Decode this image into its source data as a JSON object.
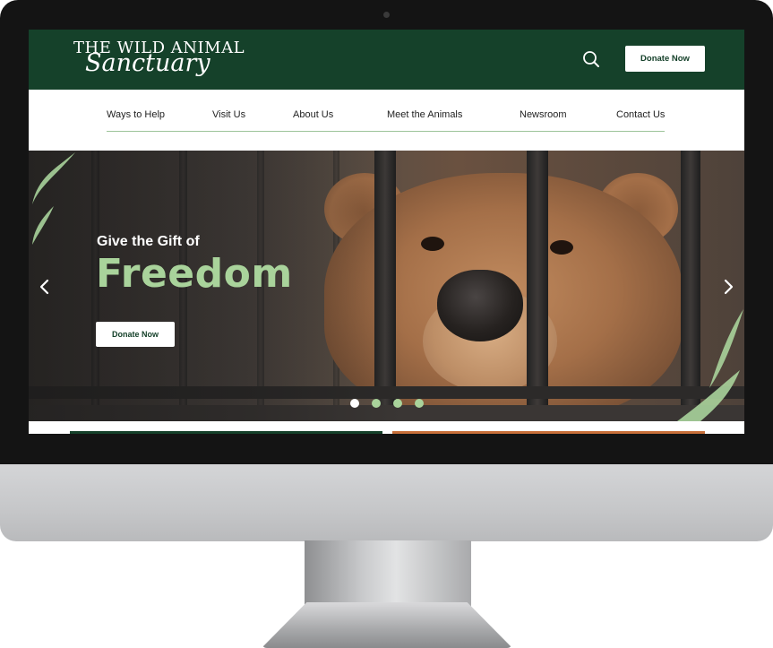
{
  "site": {
    "logo_line1": "THE WILD ANIMAL",
    "logo_line2": "Sanctuary",
    "header_donate": "Donate Now"
  },
  "nav": {
    "items": [
      {
        "label": "Ways to Help"
      },
      {
        "label": "Visit Us"
      },
      {
        "label": "About Us"
      },
      {
        "label": "Meet the Animals"
      },
      {
        "label": "Newsroom"
      },
      {
        "label": "Contact Us"
      }
    ]
  },
  "hero": {
    "kicker": "Give the Gift of",
    "title": "Freedom",
    "cta": "Donate Now",
    "slide_count": 4,
    "active_slide": 1
  },
  "icons": {
    "search": "search-icon",
    "prev": "chevron-left-icon",
    "next": "chevron-right-icon"
  },
  "colors": {
    "brand_green": "#15412a",
    "accent_green": "#a9d39b",
    "card_orange": "#c8703a"
  }
}
